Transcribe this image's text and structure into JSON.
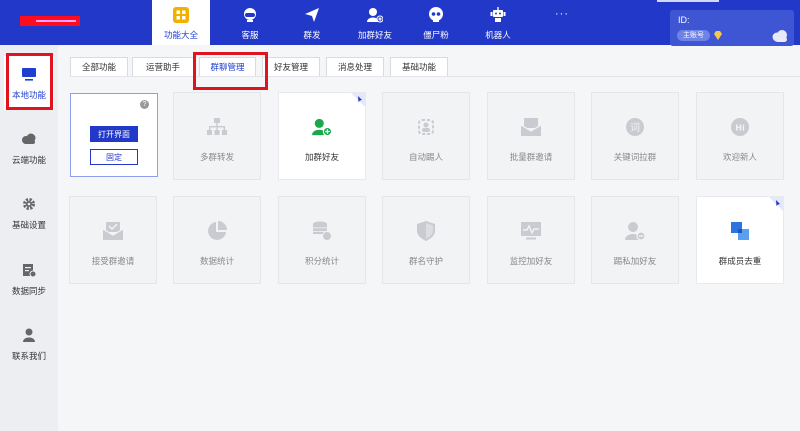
{
  "colors": {
    "brand": "#2238c8",
    "active_text": "#1f3fd0",
    "highlight": "#e0141e",
    "green": "#19a84c",
    "blue_tile": "#2a75e0"
  },
  "topnav": [
    {
      "label": "功能大全",
      "icon": "grid-icon",
      "active": true
    },
    {
      "label": "客服",
      "icon": "headset-icon",
      "active": false
    },
    {
      "label": "群发",
      "icon": "send-icon",
      "active": false
    },
    {
      "label": "加群好友",
      "icon": "add-user-icon",
      "active": false
    },
    {
      "label": "僵尸粉",
      "icon": "skull-icon",
      "active": false
    },
    {
      "label": "机器人",
      "icon": "robot-icon",
      "active": false
    }
  ],
  "more": "···",
  "account": {
    "id_label": "ID:",
    "tag": "主账号"
  },
  "sidebar": [
    {
      "label": "本地功能",
      "icon": "monitor-icon",
      "active": true
    },
    {
      "label": "云端功能",
      "icon": "cloud-icon",
      "active": false
    },
    {
      "label": "基础设置",
      "icon": "gear-icon",
      "active": false
    },
    {
      "label": "数据同步",
      "icon": "sync-icon",
      "active": false
    },
    {
      "label": "联系我们",
      "icon": "contact-icon",
      "active": false
    }
  ],
  "tabs": [
    {
      "label": "全部功能",
      "active": false
    },
    {
      "label": "运营助手",
      "active": false
    },
    {
      "label": "群聊管理",
      "active": true
    },
    {
      "label": "好友管理",
      "active": false
    },
    {
      "label": "消息处理",
      "active": false
    },
    {
      "label": "基础功能",
      "active": false
    }
  ],
  "first_card": {
    "help": "?",
    "open_button": "打开界面",
    "pin_button": "固定"
  },
  "cards_row1": [
    {
      "label": "多群转发",
      "icon": "tree-icon",
      "enabled": false,
      "pinned": false
    },
    {
      "label": "加群好友",
      "icon": "add-user-icon",
      "enabled": true,
      "pinned": true
    },
    {
      "label": "自动踢人",
      "icon": "kick-icon",
      "enabled": false,
      "pinned": false
    },
    {
      "label": "批量群邀请",
      "icon": "mail-icon",
      "enabled": false,
      "pinned": false
    },
    {
      "label": "关键词拉群",
      "icon": "keyword-icon",
      "enabled": false,
      "pinned": false
    },
    {
      "label": "欢迎新人",
      "icon": "hi-icon",
      "enabled": false,
      "pinned": false
    }
  ],
  "cards_row2": [
    {
      "label": "接受群邀请",
      "icon": "mail-check-icon",
      "enabled": false,
      "pinned": false
    },
    {
      "label": "数据统计",
      "icon": "pie-icon",
      "enabled": false,
      "pinned": false
    },
    {
      "label": "积分统计",
      "icon": "coins-icon",
      "enabled": false,
      "pinned": false
    },
    {
      "label": "群名守护",
      "icon": "shield-icon",
      "enabled": false,
      "pinned": false
    },
    {
      "label": "监控加好友",
      "icon": "monitor-pulse-icon",
      "enabled": false,
      "pinned": false
    },
    {
      "label": "踢私加好友",
      "icon": "user-block-icon",
      "enabled": false,
      "pinned": false
    },
    {
      "label": "群成员去重",
      "icon": "dedupe-icon",
      "enabled": true,
      "pinned": true
    }
  ]
}
